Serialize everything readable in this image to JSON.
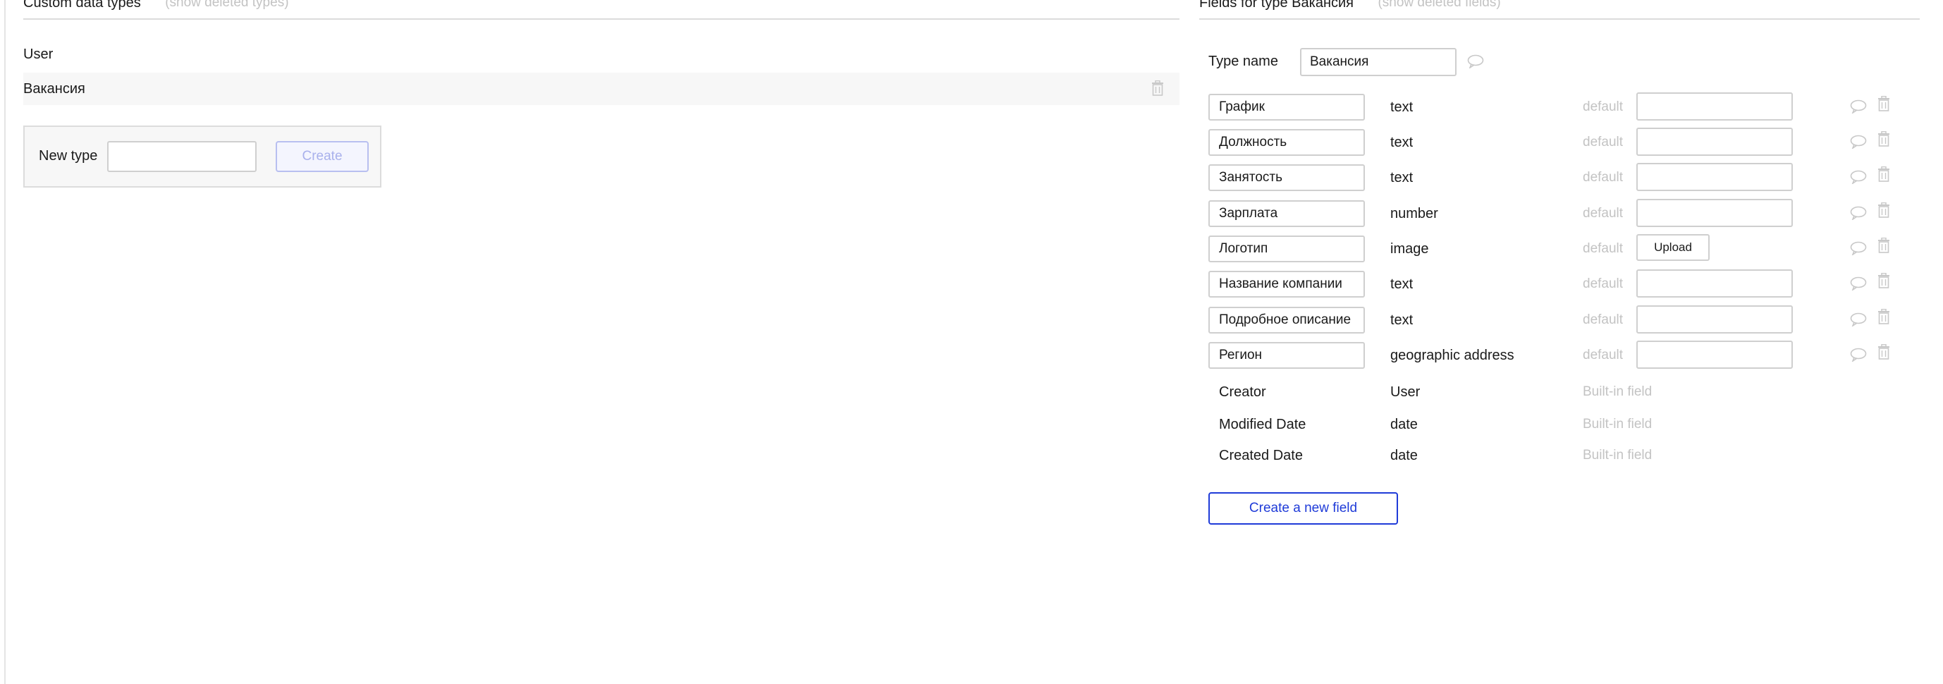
{
  "left_panel": {
    "title": "Custom data types",
    "show_deleted": "(show deleted types)",
    "types": [
      {
        "label": "User"
      },
      {
        "label": "Вакансия"
      }
    ],
    "new_type": {
      "label": "New type",
      "value": "",
      "create_label": "Create"
    }
  },
  "right_panel": {
    "title": "Fields for type Вакансия",
    "show_deleted": "(show deleted fields)",
    "type_name_label": "Type name",
    "type_name_value": "Вакансия",
    "default_label": "default",
    "upload_label": "Upload",
    "fields": [
      {
        "name": "График",
        "type": "text"
      },
      {
        "name": "Должность",
        "type": "text"
      },
      {
        "name": "Занятость",
        "type": "text"
      },
      {
        "name": "Зарплата",
        "type": "number"
      },
      {
        "name": "Логотип",
        "type": "image"
      },
      {
        "name": "Название компании",
        "type": "text"
      },
      {
        "name": "Подробное описание",
        "type": "text"
      },
      {
        "name": "Регион",
        "type": "geographic address"
      }
    ],
    "builtin_fields": [
      {
        "name": "Creator",
        "type": "User",
        "note": "Built-in field"
      },
      {
        "name": "Modified Date",
        "type": "date",
        "note": "Built-in field"
      },
      {
        "name": "Created Date",
        "type": "date",
        "note": "Built-in field"
      }
    ],
    "create_field_label": "Create a new field"
  },
  "colors": {
    "accent": "#1f3bd8",
    "muted_text": "#c3c3c3",
    "border": "#cfcfcf",
    "selected_row_bg": "#f7f7f7"
  },
  "icons": [
    "comment-icon",
    "trash-icon"
  ]
}
